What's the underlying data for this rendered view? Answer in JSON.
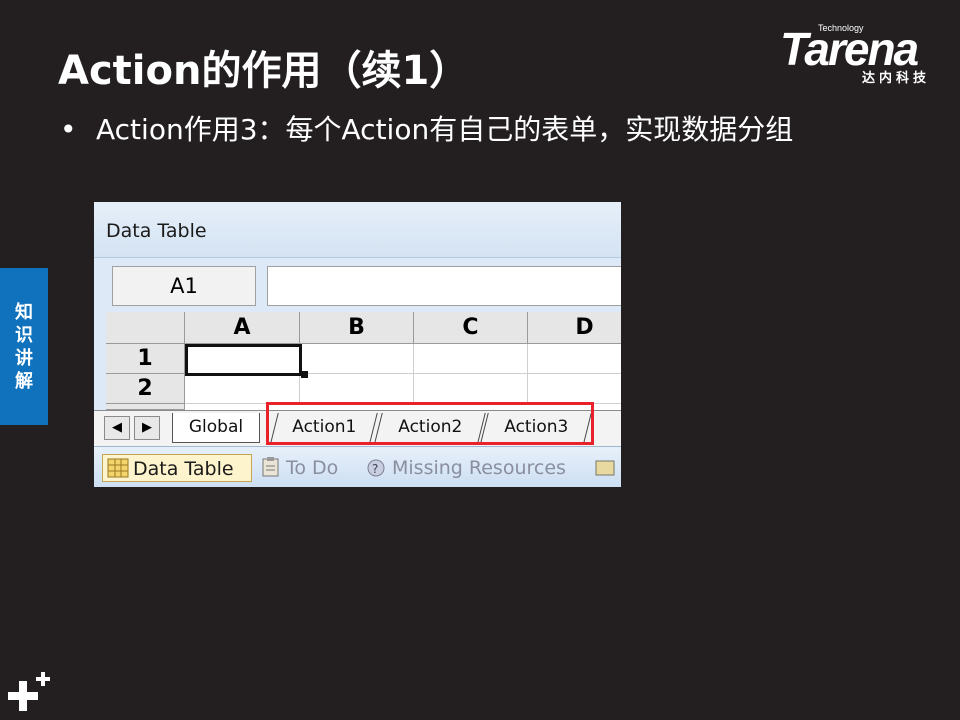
{
  "slide": {
    "title": "Action的作用（续1）",
    "bullet_marker": "•",
    "bullet_text": "Action作用3：每个Action有自己的表单，实现数据分组"
  },
  "logo": {
    "small": "Technology",
    "main": "Tarena",
    "sub": "达内科技"
  },
  "side_tab": {
    "chars": [
      "知",
      "识",
      "讲",
      "解"
    ]
  },
  "screenshot": {
    "title": "Data Table",
    "name_box": "A1",
    "formula": "",
    "columns": [
      "A",
      "B",
      "C",
      "D"
    ],
    "rows": [
      "1",
      "2"
    ],
    "nav_prev": "◀",
    "nav_next": "▶",
    "sheet_tabs": [
      "Global",
      "Action1",
      "Action2",
      "Action3"
    ],
    "bottom_tabs": [
      "Data Table",
      "To Do",
      "Missing Resources"
    ]
  },
  "colors": {
    "background": "#231f20",
    "side_tab": "#1072bd",
    "highlight": "#e8212b"
  }
}
